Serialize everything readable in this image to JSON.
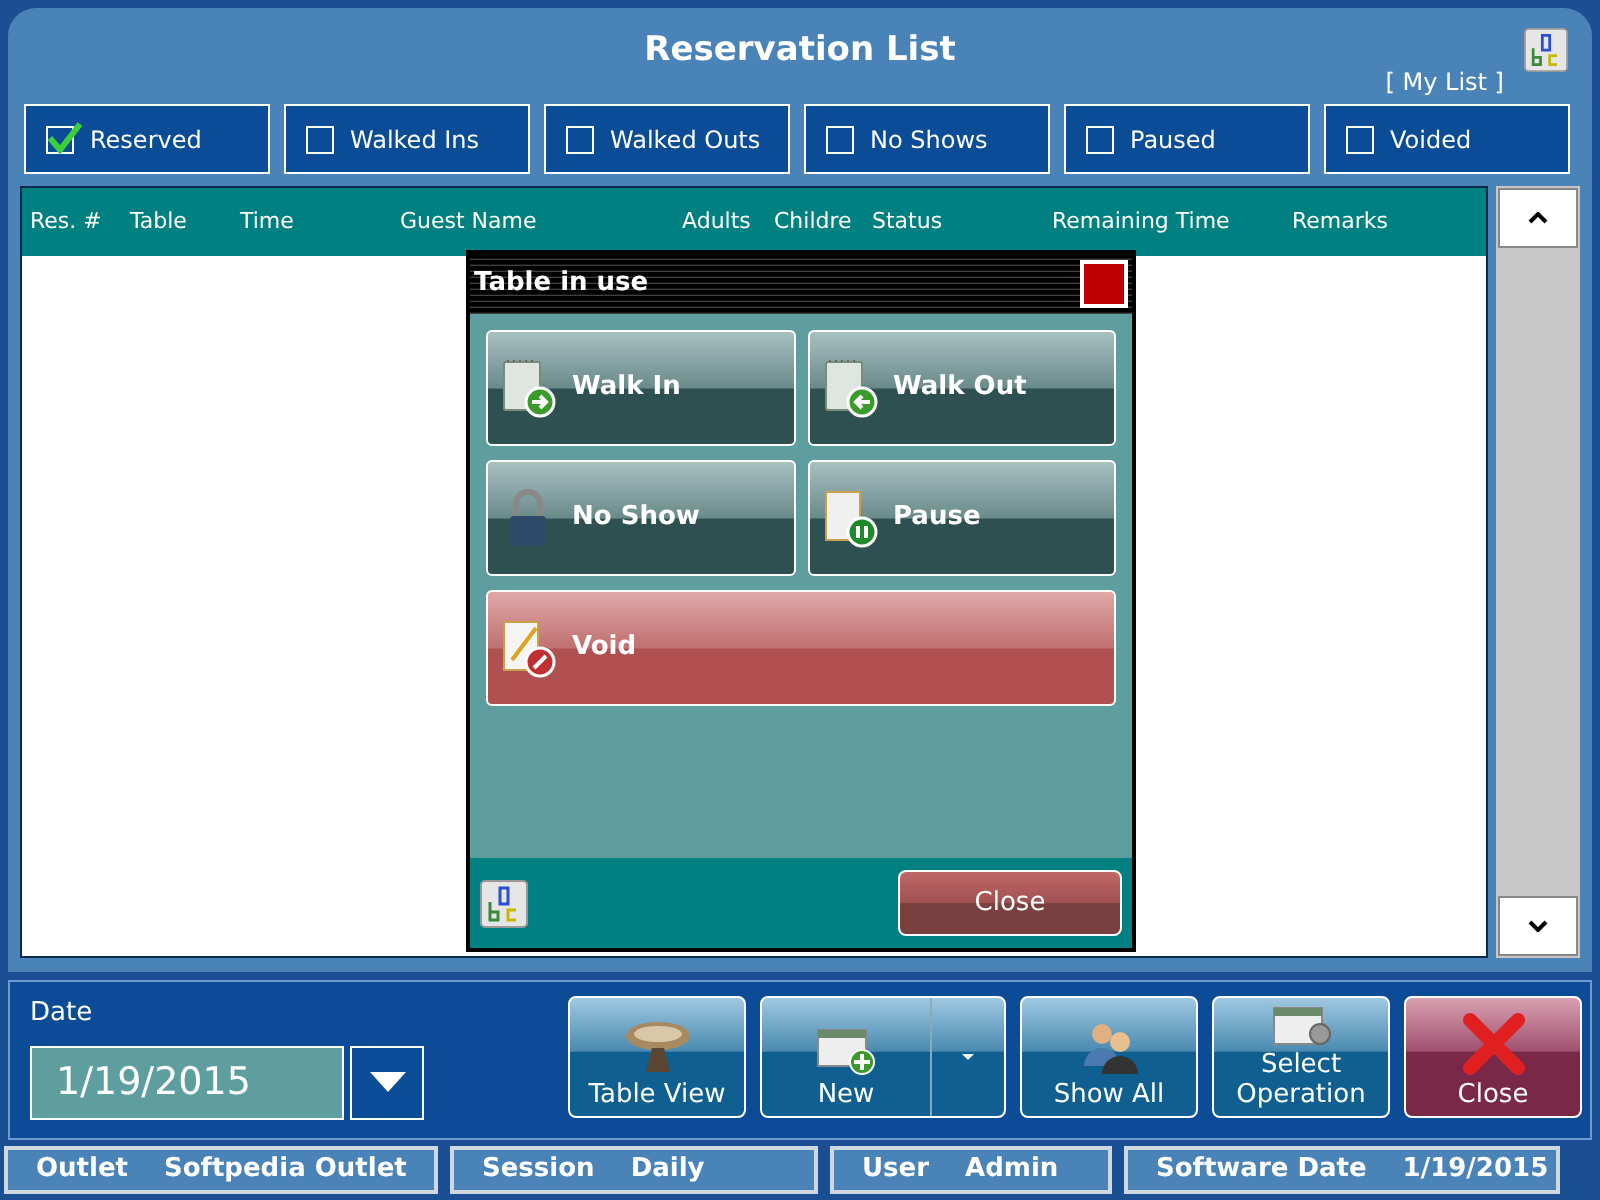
{
  "window": {
    "title": "Reservation List",
    "link": "[ My List ]"
  },
  "filters": [
    {
      "label": "Reserved",
      "checked": true
    },
    {
      "label": "Walked Ins",
      "checked": false
    },
    {
      "label": "Walked Outs",
      "checked": false
    },
    {
      "label": "No Shows",
      "checked": false
    },
    {
      "label": "Paused",
      "checked": false
    },
    {
      "label": "Voided",
      "checked": false
    }
  ],
  "table": {
    "columns": [
      "Res. #",
      "Table",
      "Time",
      "Guest Name",
      "Adults",
      "Childre",
      "Status",
      "Remaining Time",
      "Remarks"
    ]
  },
  "dialog": {
    "title": "Table in use",
    "actions": [
      {
        "label": "Walk In",
        "kind": "walk_in"
      },
      {
        "label": "Walk Out",
        "kind": "walk_out"
      },
      {
        "label": "No Show",
        "kind": "no_show"
      },
      {
        "label": "Pause",
        "kind": "pause"
      },
      {
        "label": "Void",
        "kind": "void"
      }
    ],
    "close_button": "Close"
  },
  "date": {
    "label": "Date",
    "value": "1/19/2015"
  },
  "toolbar": [
    {
      "label": "Table View",
      "kind": "table"
    },
    {
      "label": "New",
      "kind": "new"
    },
    {
      "label": "Show All",
      "kind": "users"
    },
    {
      "label": "Select Operation",
      "kind": "operation"
    },
    {
      "label": "Close",
      "kind": "close"
    }
  ],
  "status_bar": [
    {
      "label": "Outlet",
      "value": "Softpedia Outlet"
    },
    {
      "label": "Session",
      "value": "Daily"
    },
    {
      "label": "User",
      "value": "Admin"
    },
    {
      "label": "Software Date",
      "value": "1/19/2015"
    }
  ]
}
